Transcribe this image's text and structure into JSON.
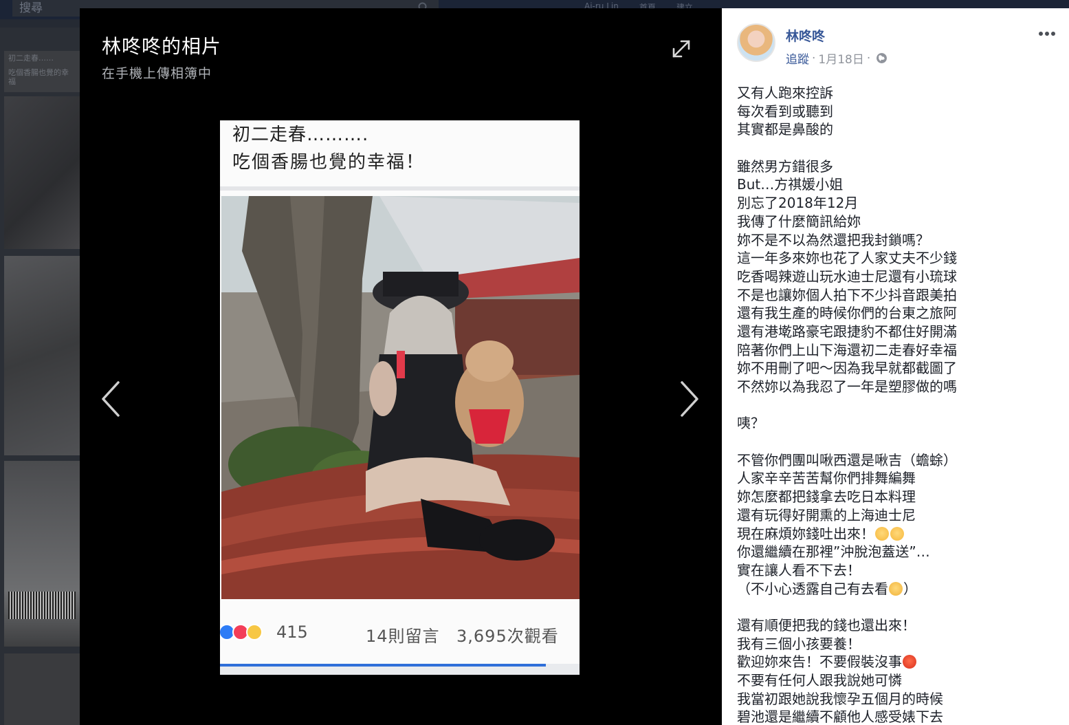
{
  "background_page": {
    "search_placeholder": "搜尋",
    "topbar_user": "Ai-ru Lin",
    "topbar_home": "首頁",
    "topbar_create": "建立",
    "thumb_text_1": "初二走春……",
    "thumb_text_2": "吃個香腸也覺的幸福"
  },
  "lightbox": {
    "album_title": "林咚咚的相片",
    "album_subtitle": "在手機上傳相簿中"
  },
  "photo": {
    "caption_line_1": "初二走春……….",
    "caption_line_2": "吃個香腸也覺的幸福！",
    "reaction_count": "415",
    "comment_count": "14則留言",
    "view_count": "3,695次觀看"
  },
  "post": {
    "author": "林咚咚",
    "follow": "追蹤",
    "separator": "·",
    "date": "1月18日",
    "lines": [
      "又有人跑來控訴",
      "每次看到或聽到",
      "其實都是鼻酸的",
      "",
      "雖然男方錯很多",
      "But…方祺媛小姐",
      "別忘了2018年12月",
      "我傳了什麼簡訊給妳",
      "妳不是不以為然還把我封鎖嗎？",
      "這一年多來妳也花了人家丈夫不少錢",
      "吃香喝辣遊山玩水迪士尼還有小琉球",
      "不是也讓妳個人拍下不少抖音跟美拍",
      "還有我生產的時候你們的台東之旅阿",
      "還有港墘路豪宅跟捷豹不都住好開滿",
      "陪著你們上山下海還初二走春好幸福",
      "妳不用刪了吧～因為我早就都截圖了",
      "不然妳以為我忍了一年是塑膠做的嗎",
      "",
      "咦？",
      "",
      "不管你們團叫啾西還是啾吉（蟾蜍）",
      "人家辛辛苦苦幫你們排舞編舞",
      "妳怎麼都把錢拿去吃日本料理",
      "還有玩得好開熏的上海迪士尼",
      "現在麻煩妳錢吐出來！",
      "你還繼續在那裡”沖脫泡蓋送”…",
      "實在讓人看不下去！",
      "（不小心透露自己有去看",
      "",
      "還有順便把我的錢也還出來！",
      "我有三個小孩要養！",
      "歡迎妳來告！不要假裝沒事",
      "不要有任何人跟我說她可憐",
      "我當初跟她說我懷孕五個月的時候",
      "碧池還是繼續不顧他人感受婊下去"
    ],
    "line_28_suffix": "）"
  },
  "colors": {
    "link_blue": "#385898",
    "meta_gray": "#90949c",
    "lightbox_bg": "#000000",
    "panel_bg": "#ffffff",
    "like_blue": "#2d7cf6",
    "love_red": "#f33e58",
    "haha_yellow": "#f7c744"
  },
  "icons": {
    "expand": "expand-arrows-icon",
    "prev": "chevron-left-icon",
    "next": "chevron-right-icon",
    "more": "more-dots-icon",
    "privacy": "globe-icon",
    "search": "search-icon"
  }
}
